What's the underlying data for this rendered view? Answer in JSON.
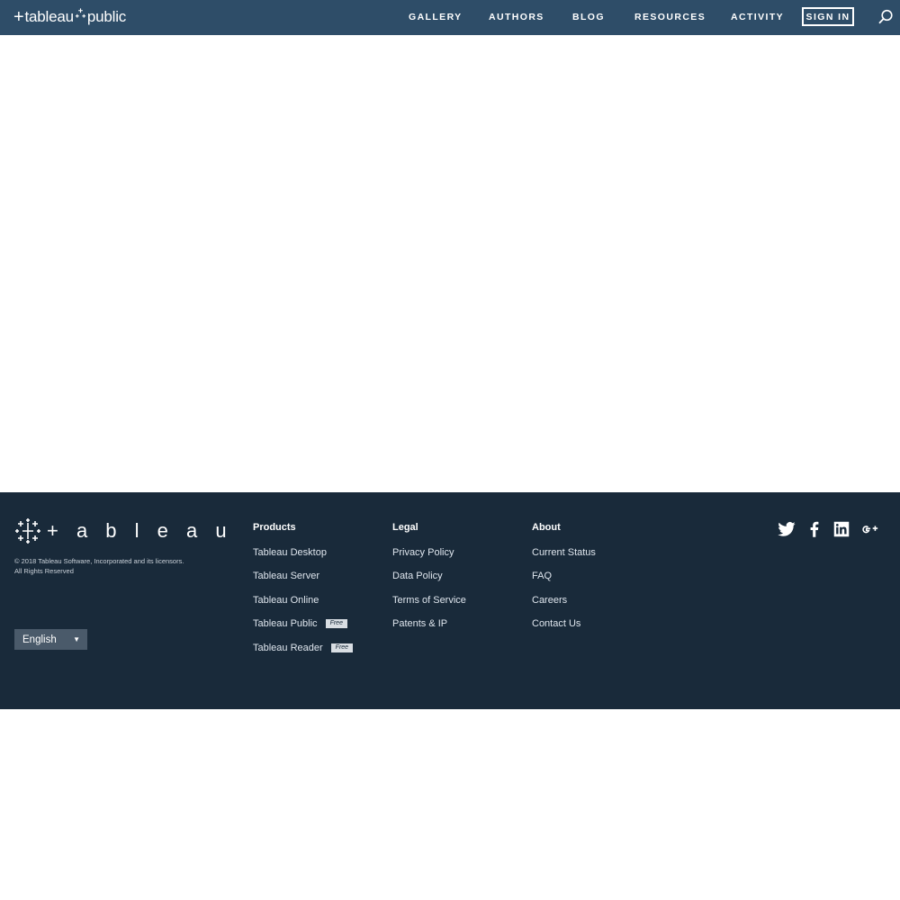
{
  "brand": {
    "name_left": "tableau",
    "name_right": "public"
  },
  "nav": {
    "items": [
      {
        "label": "GALLERY"
      },
      {
        "label": "AUTHORS"
      },
      {
        "label": "BLOG"
      },
      {
        "label": "RESOURCES"
      },
      {
        "label": "ACTIVITY"
      }
    ],
    "signin_label": "SIGN IN",
    "search_icon": "search-icon"
  },
  "colors": {
    "nav_bg": "#2e4d68",
    "footer_bg": "#192a3a",
    "badge_bg": "#d9dee3"
  },
  "footer": {
    "wordmark": "+ a b l e a u",
    "copyright_line1": "© 2018 Tableau Software, Incorporated and its licensors.",
    "copyright_line2": "All Rights Reserved",
    "language": "English",
    "columns": [
      {
        "title": "Products",
        "items": [
          {
            "label": "Tableau Desktop"
          },
          {
            "label": "Tableau Server"
          },
          {
            "label": "Tableau Online"
          },
          {
            "label": "Tableau Public",
            "badge": "Free"
          },
          {
            "label": "Tableau Reader",
            "badge": "Free"
          }
        ]
      },
      {
        "title": "Legal",
        "items": [
          {
            "label": "Privacy Policy"
          },
          {
            "label": "Data Policy"
          },
          {
            "label": "Terms of Service"
          },
          {
            "label": "Patents & IP"
          }
        ]
      },
      {
        "title": "About",
        "items": [
          {
            "label": "Current Status"
          },
          {
            "label": "FAQ"
          },
          {
            "label": "Careers"
          },
          {
            "label": "Contact Us"
          }
        ]
      }
    ],
    "social_icons": [
      "twitter-icon",
      "facebook-icon",
      "linkedin-icon",
      "google-plus-icon"
    ]
  }
}
